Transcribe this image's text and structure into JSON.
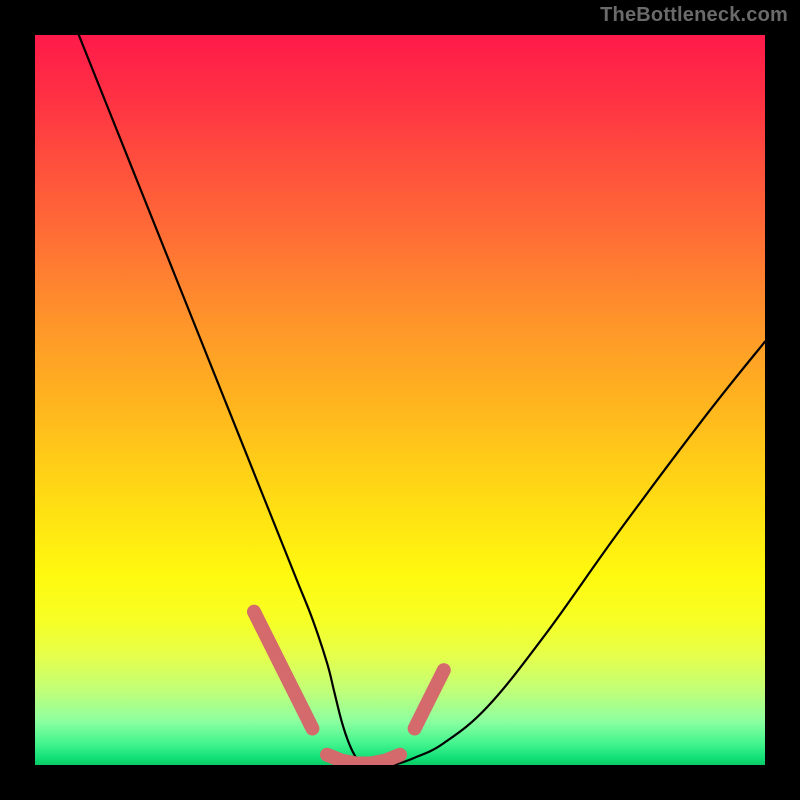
{
  "watermark": {
    "text": "TheBottleneck.com"
  },
  "colors": {
    "page_bg": "#000000",
    "curve": "#000000",
    "accent": "#d46a6c",
    "watermark_text": "#6a6a6a",
    "gradient_top": "#ff1a4a",
    "gradient_bottom": "#0ac964"
  },
  "chart_data": {
    "type": "line",
    "title": "",
    "xlabel": "",
    "ylabel": "",
    "xlim": [
      0,
      100
    ],
    "ylim": [
      0,
      100
    ],
    "grid": false,
    "legend": false,
    "series": [
      {
        "name": "bottleneck-curve",
        "x": [
          6,
          10,
          14,
          18,
          22,
          26,
          30,
          32,
          34,
          36,
          38,
          40,
          41,
          42,
          43,
          44,
          45,
          47,
          49,
          52,
          56,
          62,
          70,
          80,
          92,
          100
        ],
        "y": [
          100,
          90,
          80,
          70,
          60,
          50,
          40,
          35,
          30,
          25,
          20,
          14,
          10,
          6,
          3,
          1,
          0,
          0,
          0,
          1,
          3,
          8,
          18,
          32,
          48,
          58
        ]
      },
      {
        "name": "accent-left",
        "x": [
          30,
          32,
          34,
          36,
          38
        ],
        "y": [
          21,
          17,
          13,
          9,
          5
        ]
      },
      {
        "name": "accent-bottom",
        "x": [
          40,
          42,
          44,
          46,
          48,
          50
        ],
        "y": [
          1.4,
          0.6,
          0.2,
          0.2,
          0.6,
          1.4
        ]
      },
      {
        "name": "accent-right",
        "x": [
          52,
          54,
          56
        ],
        "y": [
          5,
          9,
          13
        ]
      }
    ],
    "annotations": []
  }
}
